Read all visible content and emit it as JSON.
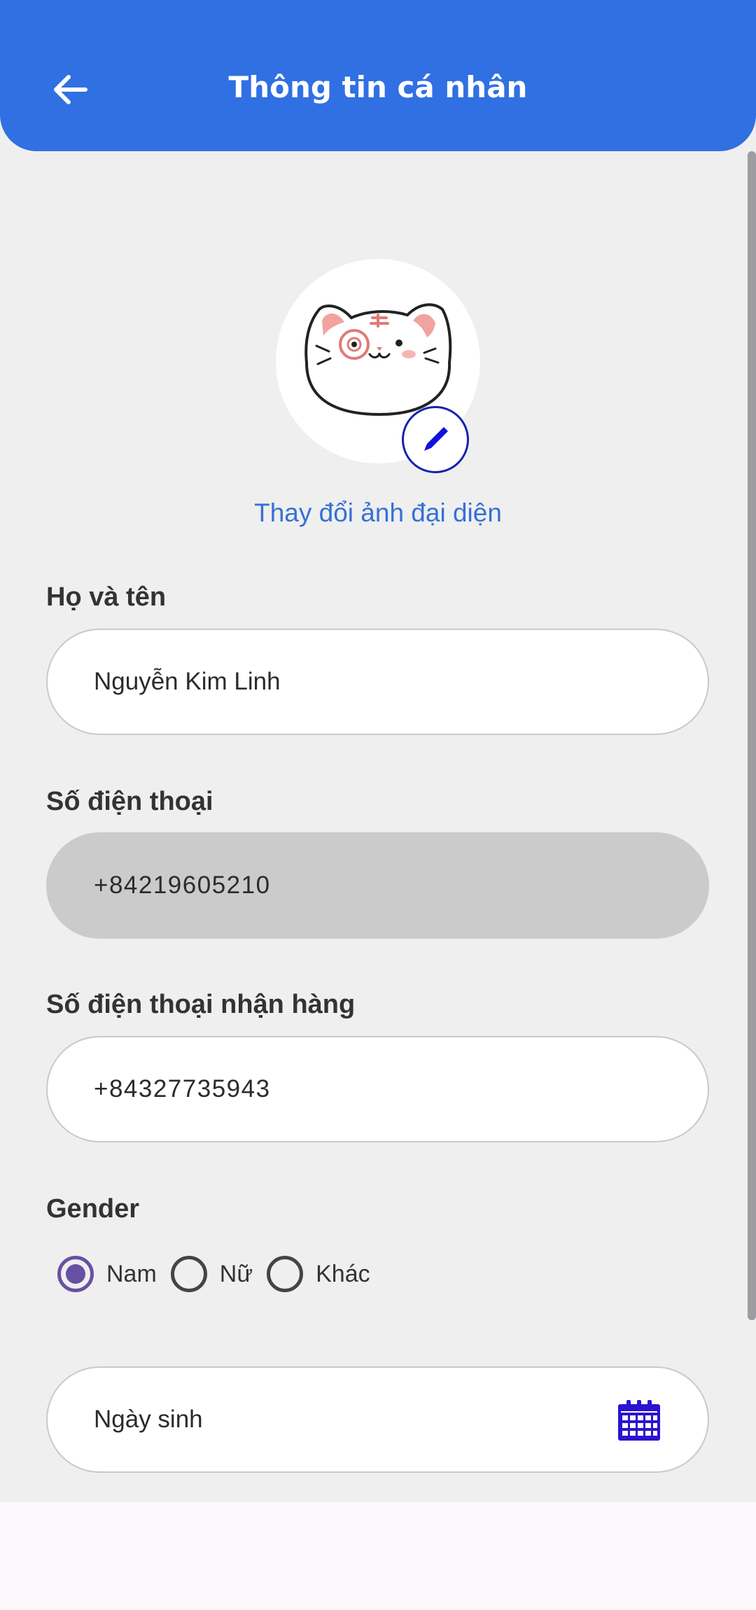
{
  "header": {
    "title": "Thông tin cá nhân"
  },
  "avatar": {
    "change_label": "Thay đổi ảnh đại diện"
  },
  "form": {
    "full_name": {
      "label": "Họ và tên",
      "value": "Nguyễn Kim Linh"
    },
    "phone": {
      "label": "Số điện thoại",
      "value": "+84219605210"
    },
    "delivery_phone": {
      "label": "Số điện thoại nhận hàng",
      "value": "+84327735943"
    },
    "gender": {
      "label": "Gender",
      "options": [
        "Nam",
        "Nữ",
        "Khác"
      ],
      "selected": "Nam"
    },
    "birthday": {
      "placeholder": "Ngày sinh"
    }
  },
  "colors": {
    "header_bg": "#3070e2",
    "accent_link": "#3670d6",
    "radio_selected": "#6750a4",
    "calendar_icon": "#2c13d0"
  },
  "icons": {
    "back": "arrow-left-icon",
    "edit": "pencil-icon",
    "calendar": "calendar-icon"
  }
}
